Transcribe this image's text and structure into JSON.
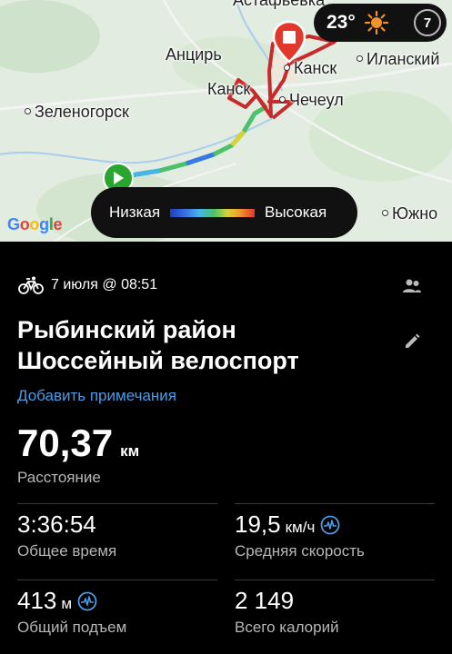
{
  "map": {
    "labels": {
      "ancir": "Анцирь",
      "kansk_city": "Канск",
      "ilansky": "Иланский",
      "kansk_route": "Канск",
      "checheul": "Чечеул",
      "zelenogorsk": "Зеленогорск",
      "yuzhno": "Южно"
    },
    "weather": {
      "temperature": "23°",
      "wind": "7"
    },
    "legend": {
      "low": "Низкая",
      "high": "Высокая"
    },
    "attribution": [
      "G",
      "o",
      "o",
      "g",
      "l",
      "e"
    ]
  },
  "activity": {
    "icon": "bicycle-icon",
    "date_time": "7 июля @ 08:51",
    "title_line1": "Рыбинский район",
    "title_line2": "Шоссейный велоспорт",
    "add_notes": "Добавить примечания",
    "distance": {
      "value": "70,37",
      "unit": "км",
      "label": "Расстояние"
    },
    "stats": [
      {
        "value": "3:36:54",
        "unit": "",
        "label": "Общее время",
        "icon": ""
      },
      {
        "value": "19,5",
        "unit": "км/ч",
        "label": "Средняя скорость",
        "icon": "heart-rate-icon"
      },
      {
        "value": "413",
        "unit": "м",
        "label": "Общий подъем",
        "icon": "heart-rate-icon"
      },
      {
        "value": "2 149",
        "unit": "",
        "label": "Всего калорий",
        "icon": ""
      }
    ]
  },
  "colors": {
    "accent_link": "#4b9be6",
    "route": "#c62a2a",
    "start": "#2aa52e"
  }
}
